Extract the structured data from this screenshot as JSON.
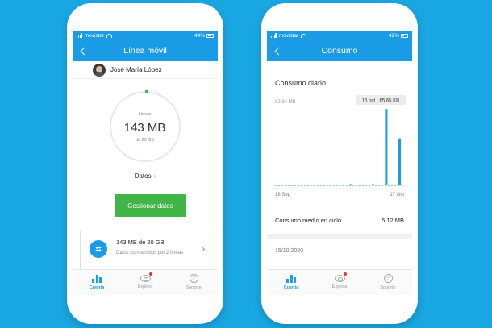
{
  "left": {
    "status": {
      "carrier": "movistar",
      "battery": "44%"
    },
    "header": {
      "title": "Línea móvil"
    },
    "user": {
      "name": "José María López"
    },
    "ring": {
      "label": "Llevas",
      "amount": "143 MB",
      "sub": "de 20 GB",
      "used_fraction": 0.007
    },
    "datos_link": "Datos",
    "manage_button": "Gestionar datos",
    "card": {
      "title": "143 MB de 20 GB",
      "description": "Datos compartidos por 2 líneas"
    },
    "tabs": [
      {
        "label": "Cuenta",
        "icon": "bar-chart-icon",
        "active": true
      },
      {
        "label": "Explora",
        "icon": "eye-icon",
        "badge": true
      },
      {
        "label": "Soporte",
        "icon": "help-icon"
      }
    ]
  },
  "right": {
    "status": {
      "carrier": "movistar",
      "battery": "42%"
    },
    "header": {
      "title": "Consumo"
    },
    "section_title": "Consumo diario",
    "avg": {
      "label": "Consumo medio en ciclo",
      "value": "5,12 MB"
    },
    "date_row": "15/10/2020",
    "tabs": [
      {
        "label": "Cuenta",
        "icon": "bar-chart-icon",
        "active": true
      },
      {
        "label": "Explora",
        "icon": "eye-icon",
        "badge": true
      },
      {
        "label": "Soporte",
        "icon": "help-icon"
      }
    ]
  },
  "chart_data": {
    "type": "bar",
    "title": "Consumo diario",
    "x_range_labels": [
      "18 Sep",
      "17 Oct"
    ],
    "y_max_label": "82,34 MB",
    "ylim": [
      0,
      82.34
    ],
    "tooltip": "15 oct · 65,65 KB",
    "categories": [
      "18 Sep",
      "19 Sep",
      "20 Sep",
      "21 Sep",
      "22 Sep",
      "23 Sep",
      "24 Sep",
      "25 Sep",
      "26 Sep",
      "27 Sep",
      "28 Sep",
      "29 Sep",
      "30 Sep",
      "1 Oct",
      "2 Oct",
      "3 Oct",
      "4 Oct",
      "5 Oct",
      "6 Oct",
      "7 Oct",
      "8 Oct",
      "9 Oct",
      "10 Oct",
      "11 Oct",
      "12 Oct",
      "13 Oct",
      "14 Oct",
      "15 Oct",
      "16 Oct",
      "17 Oct"
    ],
    "values": [
      0,
      0,
      0,
      0,
      0,
      0,
      0,
      0,
      0,
      0,
      0,
      0,
      0,
      0,
      0,
      0,
      0,
      0.4,
      0,
      0,
      0,
      0,
      0.8,
      0,
      0,
      80.5,
      0,
      0,
      49.5,
      0
    ],
    "highlight_index": 27,
    "accent": "#1a9be6"
  }
}
